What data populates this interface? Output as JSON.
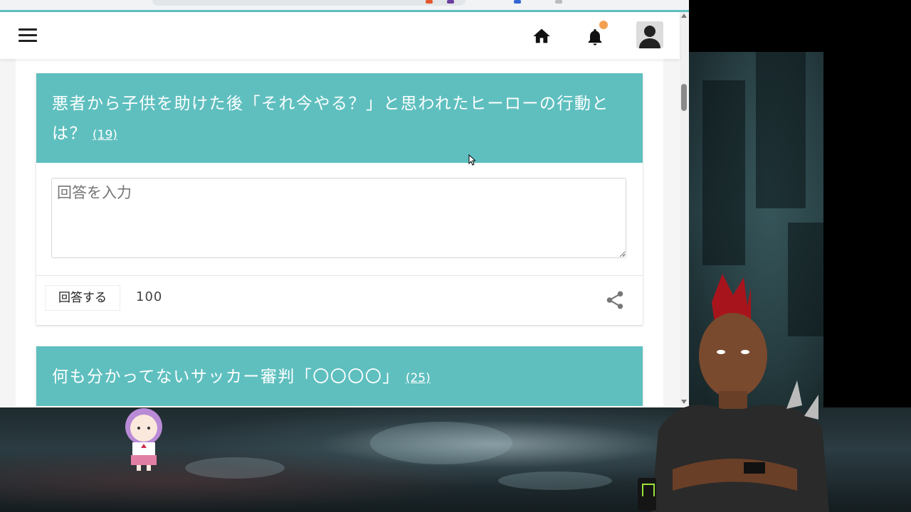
{
  "header": {
    "menu_icon": "hamburger-menu-icon",
    "home_icon": "home-icon",
    "notification_icon": "bell-icon",
    "notification_dot_color": "#f4a052",
    "avatar_icon": "user-avatar-icon"
  },
  "questions": [
    {
      "title": "悪者から子供を助けた後「それ今やる？」と思われたヒーローの行動とは？",
      "answer_count": "(19)",
      "answer_placeholder": "回答を入力",
      "submit_label": "回答する",
      "char_limit": "100",
      "share_icon": "share-icon"
    },
    {
      "title": "何も分かってないサッカー審判「〇〇〇〇」",
      "answer_count": "(25)"
    }
  ],
  "theme": {
    "accent": "#5fbfbf",
    "page_bg": "#f5f5f5"
  }
}
